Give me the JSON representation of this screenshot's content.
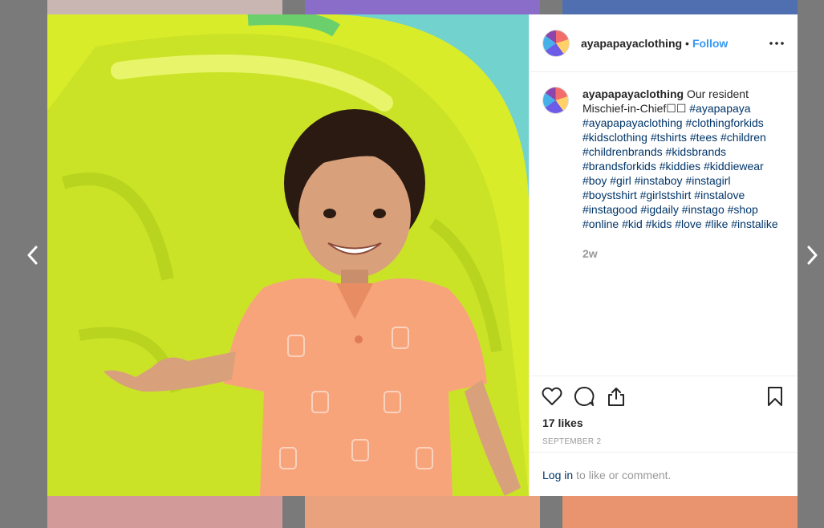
{
  "post": {
    "username": "ayapapayaclothing",
    "separator": "•",
    "follow_label": "Follow",
    "more_icon": "more-icon",
    "caption_text": "Our resident Mischief-in-Chief☐☐",
    "hashtags": [
      "#ayapapaya",
      "#ayapapayaclothing",
      "#clothingforkids",
      "#kidsclothing",
      "#tshirts",
      "#tees",
      "#children",
      "#childrenbrands",
      "#kidsbrands",
      "#brandsforkids",
      "#kiddies",
      "#kiddiewear",
      "#boy",
      "#girl",
      "#instaboy",
      "#instagirl",
      "#boystshirt",
      "#girlstshirt",
      "#instalove",
      "#instagood",
      "#igdaily",
      "#instago",
      "#shop",
      "#online",
      "#kid",
      "#kids",
      "#love",
      "#like",
      "#instalike"
    ],
    "time_ago": "2w",
    "likes": "17 likes",
    "date": "SEPTEMBER 2",
    "login_link": "Log in",
    "login_suffix": "to like or comment."
  },
  "colors": {
    "link_blue": "#3897f0",
    "hashtag_blue": "#003569",
    "overlay": "#7a7a7a"
  }
}
